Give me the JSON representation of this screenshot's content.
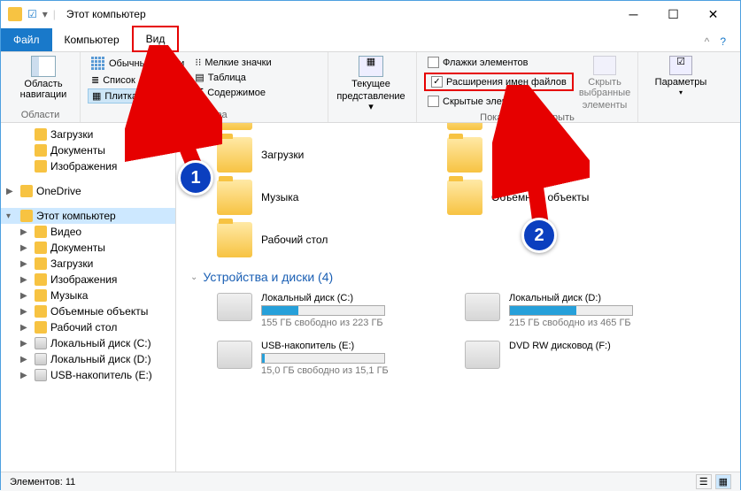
{
  "title": "Этот компьютер",
  "tabs": {
    "file": "Файл",
    "computer": "Компьютер",
    "view": "Вид"
  },
  "ribbon": {
    "panes": "Область навигации",
    "panes_group": "Области",
    "layout": {
      "large": "Обычные значки",
      "small": "Мелкие значки",
      "list": "Список",
      "table": "Таблица",
      "tile": "Плитка",
      "content": "Содержимое",
      "group": "Структура"
    },
    "current_view": [
      "Текущее",
      "представление"
    ],
    "showhide": {
      "item_checkboxes": "Флажки элементов",
      "file_ext": "Расширения имен файлов",
      "hidden": "Скрытые элементы",
      "hide_selected": [
        "Скрыть выбранные",
        "элементы"
      ],
      "group": "Показать или скрыть"
    },
    "options": "Параметры"
  },
  "nav": [
    {
      "icon": "folder",
      "label": "Загрузки",
      "indent": 1
    },
    {
      "icon": "folder",
      "label": "Документы",
      "indent": 1
    },
    {
      "icon": "folder",
      "label": "Изображения",
      "indent": 1
    },
    {
      "icon": "cloud",
      "label": "OneDrive",
      "indent": 0,
      "twisty": "▶"
    },
    {
      "icon": "pc",
      "label": "Этот компьютер",
      "indent": 0,
      "twisty": "▾",
      "selected": true
    },
    {
      "icon": "folder",
      "label": "Видео",
      "indent": 1,
      "twisty": "▶"
    },
    {
      "icon": "folder",
      "label": "Документы",
      "indent": 1,
      "twisty": "▶"
    },
    {
      "icon": "folder",
      "label": "Загрузки",
      "indent": 1,
      "twisty": "▶"
    },
    {
      "icon": "folder",
      "label": "Изображения",
      "indent": 1,
      "twisty": "▶"
    },
    {
      "icon": "folder",
      "label": "Музыка",
      "indent": 1,
      "twisty": "▶"
    },
    {
      "icon": "folder",
      "label": "Объемные объекты",
      "indent": 1,
      "twisty": "▶"
    },
    {
      "icon": "folder",
      "label": "Рабочий стол",
      "indent": 1,
      "twisty": "▶"
    },
    {
      "icon": "drive",
      "label": "Локальный диск (C:)",
      "indent": 1,
      "twisty": "▶"
    },
    {
      "icon": "drive",
      "label": "Локальный диск (D:)",
      "indent": 1,
      "twisty": "▶"
    },
    {
      "icon": "drive",
      "label": "USB-накопитель (E:)",
      "indent": 1,
      "twisty": "▶"
    }
  ],
  "folders": [
    "Загрузки",
    "Изображения",
    "Музыка",
    "Объемные объекты",
    "Рабочий стол"
  ],
  "folders_top_partial": [
    "",
    ""
  ],
  "devices_header": "Устройства и диски (4)",
  "drives": [
    {
      "name": "Локальный диск (C:)",
      "free": "155 ГБ свободно из 223 ГБ",
      "pct": 30
    },
    {
      "name": "Локальный диск (D:)",
      "free": "215 ГБ свободно из 465 ГБ",
      "pct": 54
    },
    {
      "name": "USB-накопитель (E:)",
      "free": "15,0 ГБ свободно из 15,1 ГБ",
      "pct": 2
    },
    {
      "name": "DVD RW дисковод (F:)",
      "free": "",
      "pct": null
    }
  ],
  "status": "Элементов: 11",
  "callouts": {
    "1": "1",
    "2": "2"
  }
}
